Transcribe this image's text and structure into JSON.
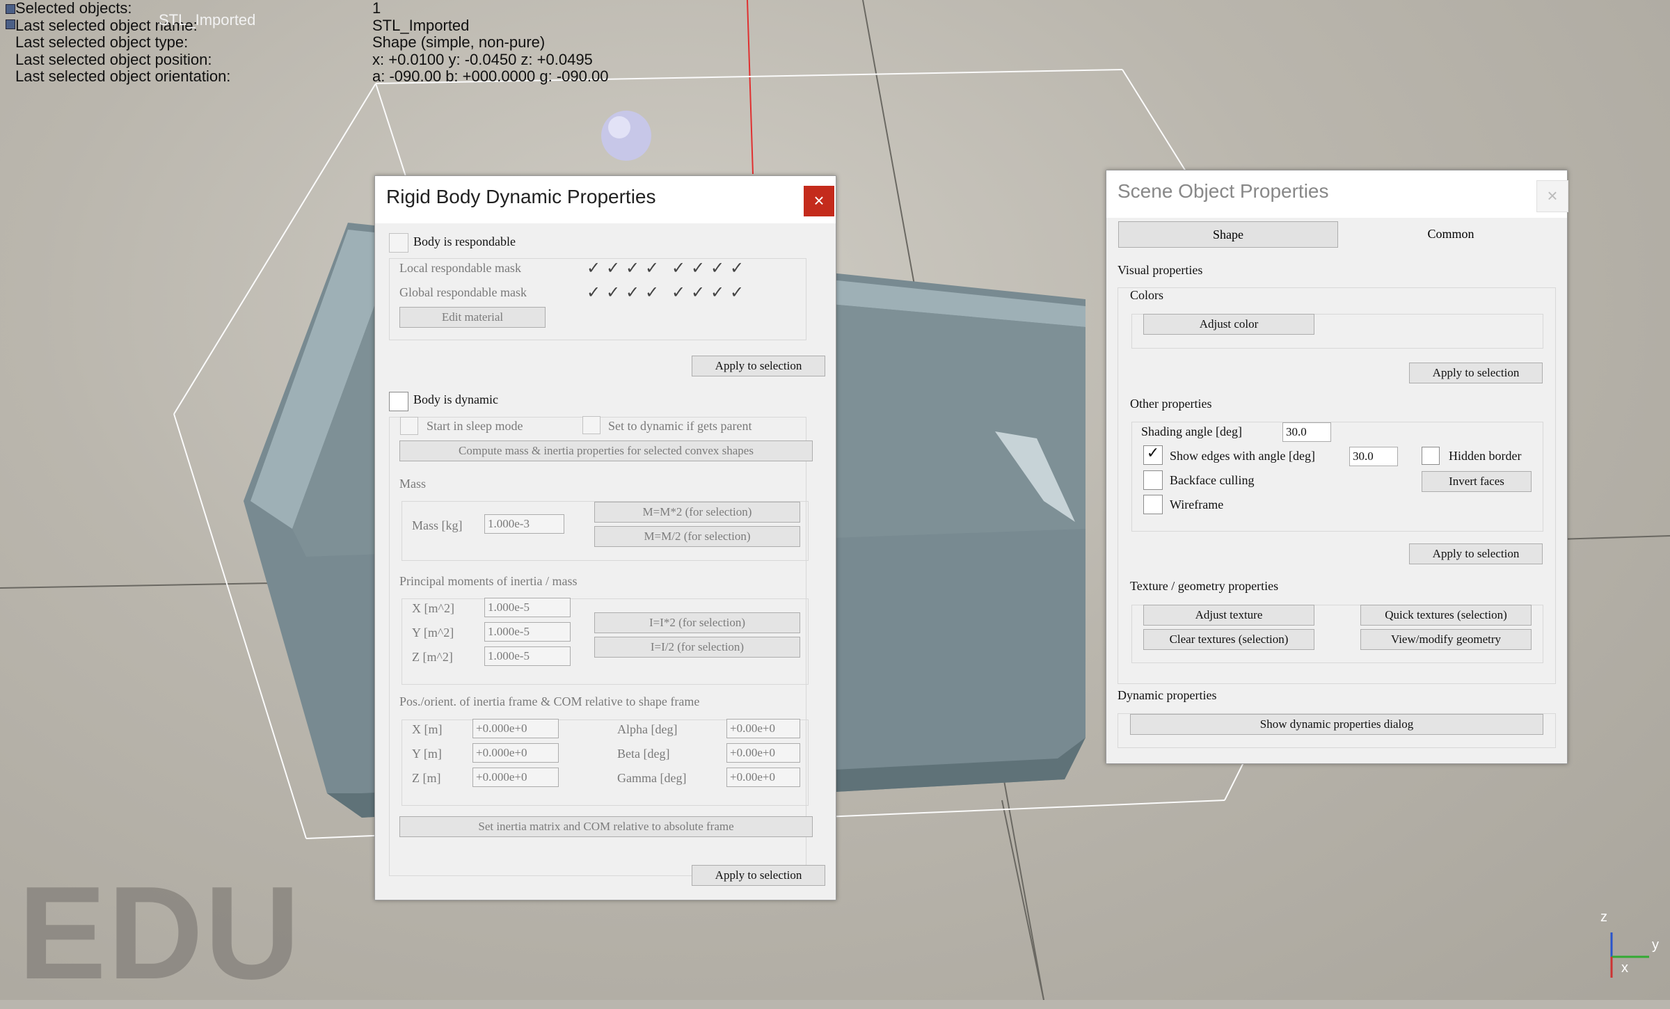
{
  "info": {
    "rows": [
      {
        "k": "Selected objects:",
        "v": "1"
      },
      {
        "k": "Last selected object name:",
        "v": "STL_Imported"
      },
      {
        "k": "Last selected object type:",
        "v": "Shape (simple, non-pure)"
      },
      {
        "k": "Last selected object position:",
        "v": "x: +0.0100    y: -0.0450    z: +0.0495"
      },
      {
        "k": "Last selected object orientation:",
        "v": "a: -090.00    b: +000.0000    g: -090.00"
      }
    ],
    "ghost_label": "STL_Imported"
  },
  "watermark": "EDU",
  "axes": {
    "z": "z",
    "y": "y",
    "x": "x"
  },
  "rigid": {
    "title": "Rigid Body Dynamic Properties",
    "close": "×",
    "respondable": "Body is respondable",
    "local_mask": "Local respondable mask",
    "global_mask": "Global respondable mask",
    "check_mark": "✓",
    "edit_material": "Edit material",
    "apply": "Apply to selection",
    "dynamic": "Body is dynamic",
    "sleep": "Start in sleep mode",
    "set_dynamic": "Set to dynamic if gets parent",
    "compute": "Compute mass & inertia properties for selected convex shapes",
    "mass_header": "Mass",
    "mass_label": "Mass [kg]",
    "mass_value": "1.000e-3",
    "mass_x2": "M=M*2  (for selection)",
    "mass_half": "M=M/2  (for selection)",
    "inertia_header": "Principal moments of inertia / mass",
    "ix_label": "X [m^2]",
    "ix": "1.000e-5",
    "iy_label": "Y [m^2]",
    "iy": "1.000e-5",
    "iz_label": "Z [m^2]",
    "iz": "1.000e-5",
    "i_x2": "I=I*2  (for selection)",
    "i_half": "I=I/2  (for selection)",
    "pos_header": "Pos./orient. of inertia frame & COM relative to shape frame",
    "px_label": "X [m]",
    "px": "+0.000e+0",
    "py_label": "Y [m]",
    "py": "+0.000e+0",
    "pz_label": "Z [m]",
    "pz": "+0.000e+0",
    "alpha_label": "Alpha [deg]",
    "alpha": "+0.00e+0",
    "beta_label": "Beta [deg]",
    "beta": "+0.00e+0",
    "gamma_label": "Gamma [deg]",
    "gamma": "+0.00e+0",
    "set_inertia": "Set inertia matrix and COM relative to absolute frame",
    "apply2": "Apply to selection"
  },
  "scene": {
    "title": "Scene Object Properties",
    "close": "×",
    "tab_shape": "Shape",
    "tab_common": "Common",
    "visual": "Visual properties",
    "colors": "Colors",
    "adjust_color": "Adjust color",
    "apply": "Apply to selection",
    "other": "Other properties",
    "shading_label": "Shading angle [deg]",
    "shading": "30.0",
    "show_edges": "Show edges with angle [deg]",
    "edges_value": "30.0",
    "hidden_border": "Hidden border",
    "backface": "Backface culling",
    "invert_faces": "Invert faces",
    "wireframe": "Wireframe",
    "apply2": "Apply to selection",
    "texture_header": "Texture / geometry properties",
    "adjust_texture": "Adjust texture",
    "quick_textures": "Quick textures (selection)",
    "clear_textures": "Clear textures (selection)",
    "view_geometry": "View/modify geometry",
    "dynamic_header": "Dynamic properties",
    "show_dynamic": "Show dynamic properties dialog",
    "check_mark": "✓"
  }
}
